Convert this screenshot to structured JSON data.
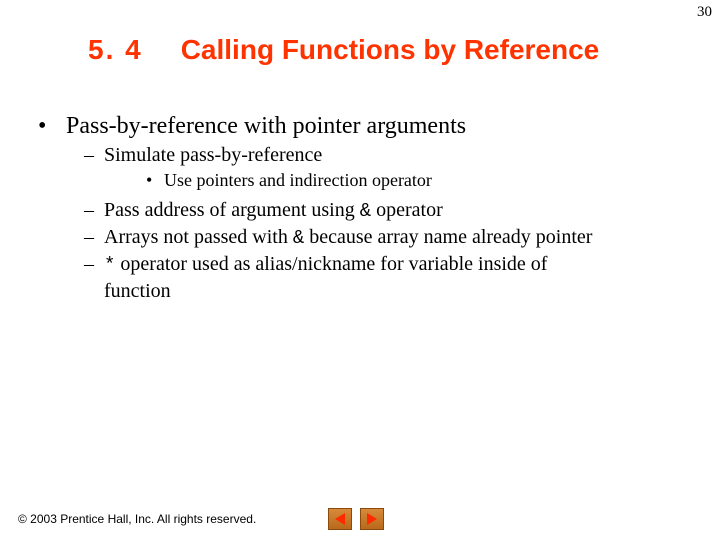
{
  "page_number": "30",
  "header": {
    "section_number": "5. 4",
    "section_title": "Calling Functions by Reference"
  },
  "bullets": {
    "l1_0": "Pass-by-reference with pointer arguments",
    "l2_0": "Simulate pass-by-reference",
    "l3_0": "Use pointers and indirection operator",
    "l2_1a": "Pass address of argument using ",
    "l2_1_op": "&",
    "l2_1b": " operator",
    "l2_2a": "Arrays not passed with ",
    "l2_2_op": "&",
    "l2_2b": " because array name already pointer",
    "l2_3_op": "*",
    "l2_3a": " operator used as alias/nickname for variable inside of",
    "l2_3b": "function"
  },
  "footer": {
    "copyright": " 2003 Prentice Hall, Inc.  All rights reserved."
  },
  "nav": {
    "prev": "previous-slide",
    "next": "next-slide"
  }
}
